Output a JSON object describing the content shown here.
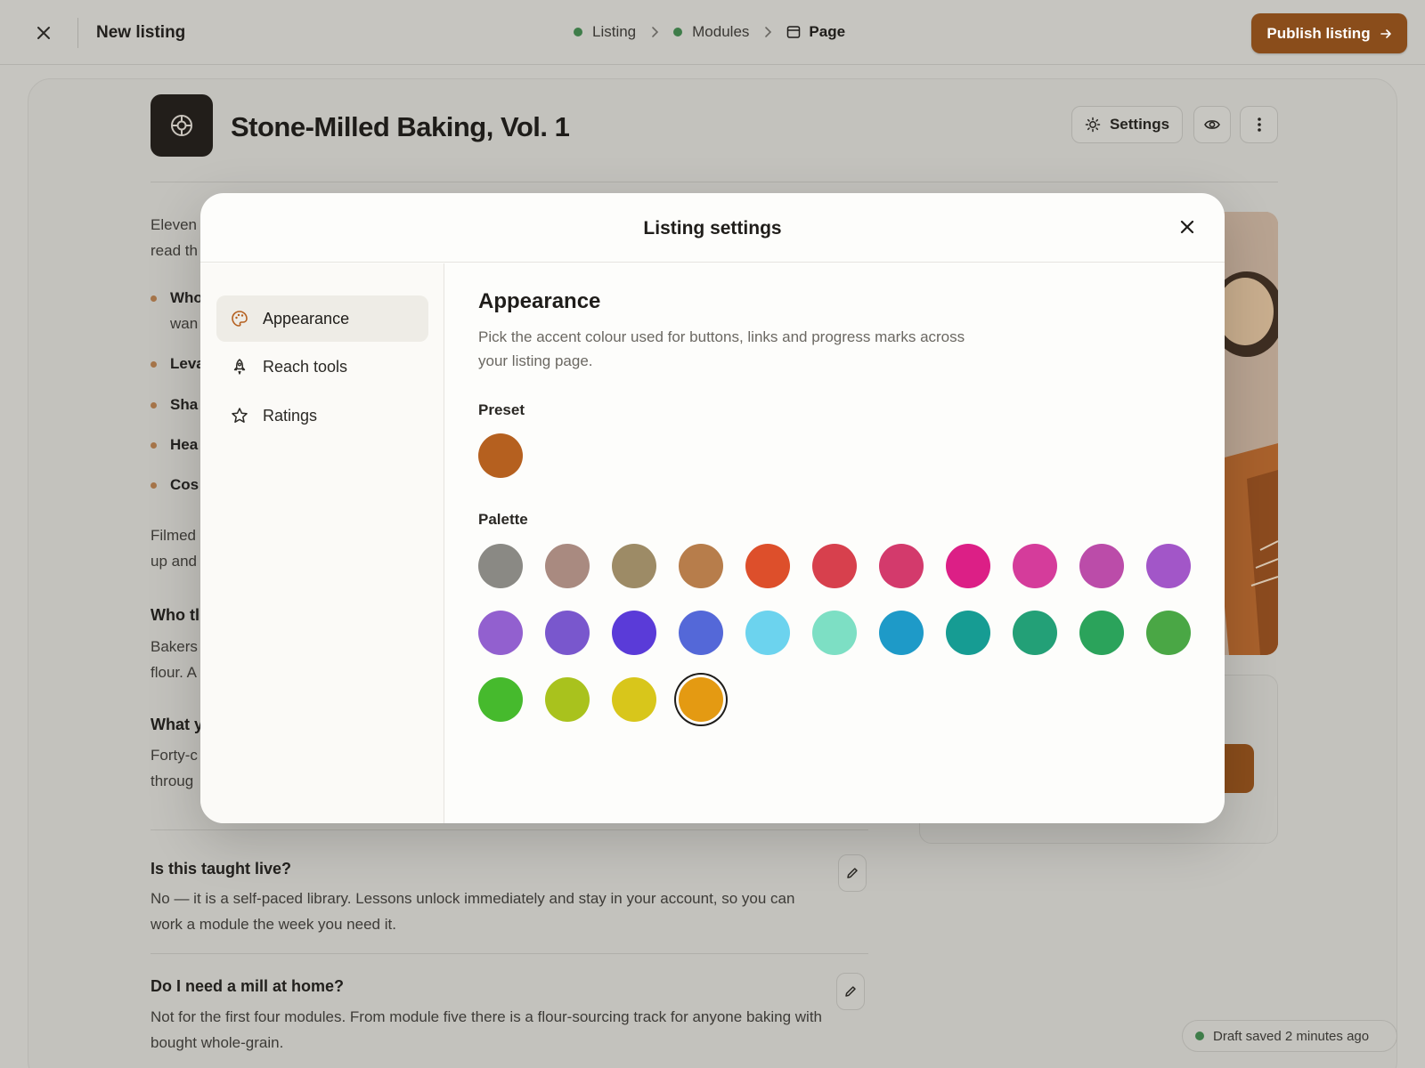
{
  "topbar": {
    "title": "New listing",
    "crumbs": [
      {
        "label": "Listing",
        "status_color": "#3f7d4a"
      },
      {
        "label": "Modules",
        "status_color": "#3f7d4a"
      },
      {
        "label": "Page"
      }
    ],
    "publish_label": "Publish listing"
  },
  "listing": {
    "title": "Stone-Milled Baking, Vol. 1",
    "settings_label": "Settings",
    "intro_line1": "Eleven",
    "intro_line2": "read th",
    "bullets": [
      {
        "line1": "Who",
        "line2": "wan"
      },
      {
        "line1": "Leva"
      },
      {
        "line1": "Sha"
      },
      {
        "line1": "Hea"
      },
      {
        "line1": "Cos"
      }
    ],
    "para2_line1": "Filmed",
    "para2_line2": "up and",
    "heading_who": "Who tl",
    "who_line1": "Bakers",
    "who_line2": "flour. A",
    "heading_what": "What y",
    "what_line1": "Forty-c",
    "what_line2": "throug"
  },
  "faq": [
    {
      "q": "Is this taught live?",
      "a": "No — it is a self-paced library. Lessons unlock immediately and stay in your account, so you can work a module the week you need it."
    },
    {
      "q": "Do I need a mill at home?",
      "a": "Not for the first four modules. From module five there is a flour-sourcing track for anyone baking with bought whole-grain."
    }
  ],
  "draft_status": "Draft saved 2 minutes ago",
  "modal": {
    "title": "Listing settings",
    "nav": [
      {
        "label": "Appearance",
        "icon": "palette-icon",
        "active": true
      },
      {
        "label": "Reach tools",
        "icon": "rocket-icon",
        "active": false
      },
      {
        "label": "Ratings",
        "icon": "star-icon",
        "active": false
      }
    ],
    "section_title": "Appearance",
    "section_desc": "Pick the accent colour used for buttons, links and progress marks across your listing page.",
    "preset_label": "Preset",
    "preset_color": "#b5601f",
    "palette_label": "Palette",
    "palette": [
      "#8a8984",
      "#a98a80",
      "#9d8b66",
      "#b77d4b",
      "#dd4f2b",
      "#d7404d",
      "#d33a6c",
      "#dc1f86",
      "#d53c9b",
      "#bb4ca9",
      "#a256c8",
      "#9260cf",
      "#7957cd",
      "#5a3bd8",
      "#5468d8",
      "#6cd3ee",
      "#7ddfc4",
      "#1e9ac8",
      "#169c93",
      "#23a077",
      "#2ba35b",
      "#4aa745",
      "#46ba2d",
      "#a9c21d",
      "#d8c61b",
      "#e49a12"
    ],
    "selected_index": 25
  }
}
